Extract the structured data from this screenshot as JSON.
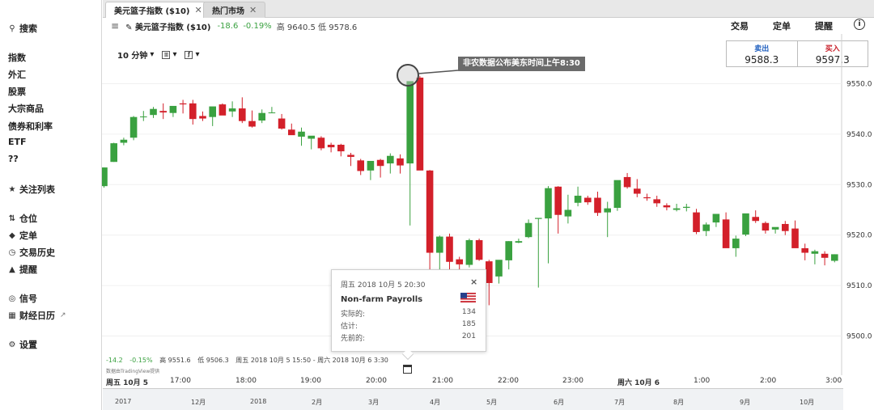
{
  "sidebar": {
    "search": "搜索",
    "categories": [
      "指数",
      "外汇",
      "股票",
      "大宗商品",
      "债券和利率",
      "ETF",
      "??"
    ],
    "watchlist": "关注列表",
    "positions": "仓位",
    "orders": "定单",
    "history": "交易历史",
    "alerts": "提醒",
    "signals": "信号",
    "calendar": "财经日历",
    "settings": "设置"
  },
  "tabs": [
    {
      "label": "美元篮子指数 ($10)",
      "close": "✕"
    },
    {
      "label": "热门市场",
      "close": "✕"
    }
  ],
  "instrument": {
    "name": "美元篮子指数 ($10)",
    "change": "-18.6",
    "change_pct": "-0.19%",
    "high_low": "高 9640.5 低 9578.6"
  },
  "actions": {
    "trade": "交易",
    "order": "定单",
    "alert": "提醒",
    "info": "i"
  },
  "quote": {
    "sell_label": "卖出",
    "sell_value": "9588.3",
    "buy_label": "买入",
    "buy_value": "9597.3"
  },
  "toolbar": {
    "interval": "10 分钟"
  },
  "annotation": "非农数据公布美东时间上午8:30",
  "ohlc_bar": {
    "change": "-14.2",
    "change_pct": "-0.15%",
    "high": "高 9551.6",
    "low": "低 9506.3",
    "range": "周五 2018 10月 5 15:50 - 周六 2018 10月 6 3:30"
  },
  "provider": "数据由TradingView提供",
  "time_axis": {
    "labels": [
      {
        "text": "周五 10月 5",
        "bold": true
      },
      {
        "text": "17:00"
      },
      {
        "text": "18:00"
      },
      {
        "text": "19:00"
      },
      {
        "text": "20:00"
      },
      {
        "text": "21:00"
      },
      {
        "text": "22:00"
      },
      {
        "text": "23:00"
      },
      {
        "text": "周六 10月 6",
        "bold": true
      },
      {
        "text": "1:00"
      },
      {
        "text": "2:00"
      },
      {
        "text": "3:00"
      }
    ]
  },
  "navigator": [
    "2017",
    "12月",
    "2018",
    "2月",
    "3月",
    "4月",
    "5月",
    "6月",
    "7月",
    "8月",
    "9月",
    "10月"
  ],
  "popup": {
    "date": "周五 2018 10月 5 20:30",
    "close": "×",
    "event": "Non-farm Payrolls",
    "rows": [
      {
        "label": "实际的:",
        "value": "134"
      },
      {
        "label": "估计:",
        "value": "185"
      },
      {
        "label": "先前的:",
        "value": "201"
      }
    ]
  },
  "colors": {
    "up": "#3aa140",
    "down": "#d3202a",
    "sell": "#1f5fbf",
    "buy": "#c8202a"
  },
  "chart_data": {
    "type": "candlestick",
    "x_labels": [
      "周五 10月 5",
      "17:00",
      "18:00",
      "19:00",
      "20:00",
      "21:00",
      "22:00",
      "23:00",
      "周六 10月 6",
      "1:00",
      "2:00",
      "3:00"
    ],
    "y_ticks": [
      9500.0,
      9510.0,
      9520.0,
      9530.0,
      9540.0,
      9550.0
    ],
    "ylim": [
      9495,
      9558
    ],
    "candles": [
      [
        9529.7,
        9533.4,
        9529.4,
        9533.4
      ],
      [
        9534.5,
        9538.3,
        9534.5,
        9538.2
      ],
      [
        9538.3,
        9539.3,
        9537.8,
        9538.9
      ],
      [
        9539.3,
        9543.6,
        9538.8,
        9543.4
      ],
      [
        9543.4,
        9544.6,
        9542.6,
        9543.5
      ],
      [
        9543.8,
        9545.4,
        9543.2,
        9545.0
      ],
      [
        9544.6,
        9546.1,
        9543.0,
        9544.3
      ],
      [
        9544.2,
        9545.3,
        9543.4,
        9545.6
      ],
      [
        9546.1,
        9546.8,
        9544.1,
        9545.9
      ],
      [
        9546.1,
        9546.8,
        9541.9,
        9543.0
      ],
      [
        9543.6,
        9544.5,
        9542.6,
        9543.1
      ],
      [
        9543.4,
        9545.1,
        9541.6,
        9545.5
      ],
      [
        9545.9,
        9546.1,
        9543.9,
        9543.7
      ],
      [
        9544.5,
        9546.5,
        9543.4,
        9545.1
      ],
      [
        9545.1,
        9547.3,
        9542.2,
        9542.6
      ],
      [
        9542.6,
        9544.7,
        9541.3,
        9541.5
      ],
      [
        9542.7,
        9544.9,
        9542.2,
        9544.2
      ],
      [
        9544.3,
        9545.4,
        9544.2,
        9544.3
      ],
      [
        9543.1,
        9544.0,
        9540.9,
        9541.1
      ],
      [
        9540.9,
        9542.1,
        9540.2,
        9539.8
      ],
      [
        9539.5,
        9541.3,
        9537.7,
        9540.5
      ],
      [
        9539.1,
        9539.3,
        9537.0,
        9539.7
      ],
      [
        9539.3,
        9539.6,
        9536.8,
        9537.2
      ],
      [
        9537.9,
        9538.3,
        9536.4,
        9537.4
      ],
      [
        9537.9,
        9538.1,
        9535.6,
        9536.6
      ],
      [
        9535.9,
        9536.3,
        9533.7,
        9535.5
      ],
      [
        9534.8,
        9535.1,
        9531.9,
        9532.7
      ],
      [
        9532.8,
        9534.1,
        9530.9,
        9534.7
      ],
      [
        9534.9,
        9535.1,
        9531.4,
        9533.7
      ],
      [
        9534.2,
        9536.2,
        9532.2,
        9535.7
      ],
      [
        9535.2,
        9536.0,
        9532.2,
        9533.8
      ],
      [
        9534.2,
        9536.6,
        9521.9,
        9550.5
      ],
      [
        9551.2,
        9551.5,
        9534.8,
        9532.8
      ],
      [
        9532.8,
        9532.9,
        9508.6,
        9516.5
      ],
      [
        9516.5,
        9519.9,
        9510.9,
        9519.7
      ],
      [
        9519.7,
        9520.3,
        9512.9,
        9514.7
      ],
      [
        9515.2,
        9515.7,
        9511.4,
        9514.2
      ],
      [
        9514.1,
        9519.3,
        9513.6,
        9519.0
      ],
      [
        9519.0,
        9519.3,
        9514.9,
        9515.1
      ],
      [
        9514.8,
        9515.1,
        9506.1,
        9510.5
      ],
      [
        9511.8,
        9514.6,
        9510.4,
        9515.1
      ],
      [
        9515.0,
        9518.8,
        9513.2,
        9518.8
      ],
      [
        9518.5,
        9519.3,
        9518.4,
        9518.8
      ],
      [
        9519.6,
        9523.1,
        9519.4,
        9522.4
      ],
      [
        9523.2,
        9523.4,
        9509.6,
        9523.4
      ],
      [
        9523.3,
        9529.7,
        9514.4,
        9529.3
      ],
      [
        9529.6,
        9529.7,
        9520.3,
        9524.0
      ],
      [
        9523.7,
        9528.0,
        9522.3,
        9525.0
      ],
      [
        9526.4,
        9529.6,
        9525.7,
        9527.8
      ],
      [
        9527.4,
        9527.8,
        9526.0,
        9526.5
      ],
      [
        9527.4,
        9528.6,
        9523.8,
        9524.4
      ],
      [
        9524.5,
        9526.6,
        9519.6,
        9525.3
      ],
      [
        9525.4,
        9529.5,
        9524.8,
        9530.9
      ],
      [
        9531.5,
        9532.3,
        9529.2,
        9529.5
      ],
      [
        9529.2,
        9531.1,
        9527.5,
        9528.2
      ],
      [
        9527.5,
        9528.2,
        9526.8,
        9527.3
      ],
      [
        9527.1,
        9527.8,
        9525.6,
        9526.3
      ],
      [
        9525.9,
        9526.3,
        9524.9,
        9525.5
      ],
      [
        9525.0,
        9526.2,
        9524.7,
        9525.3
      ],
      [
        9525.4,
        9526.2,
        9524.7,
        9525.6
      ],
      [
        9524.5,
        9525.2,
        9520.2,
        9520.6
      ],
      [
        9520.8,
        9522.5,
        9519.8,
        9522.1
      ],
      [
        9522.5,
        9523.4,
        9521.6,
        9524.2
      ],
      [
        9523.1,
        9524.5,
        9518.2,
        9517.4
      ],
      [
        9517.4,
        9519.9,
        9515.7,
        9519.3
      ],
      [
        9520.1,
        9524.2,
        9519.8,
        9524.3
      ],
      [
        9523.6,
        9524.9,
        9522.4,
        9522.8
      ],
      [
        9522.4,
        9522.7,
        9520.3,
        9520.9
      ],
      [
        9521.1,
        9521.4,
        9520.3,
        9521.6
      ],
      [
        9522.2,
        9522.8,
        9520.0,
        9520.8
      ],
      [
        9521.3,
        9522.9,
        9520.8,
        9517.4
      ],
      [
        9517.4,
        9518.3,
        9515.0,
        9516.5
      ],
      [
        9516.3,
        9517.1,
        9514.2,
        9516.8
      ],
      [
        9516.3,
        9516.8,
        9514.0,
        9515.5
      ],
      [
        9514.9,
        9516.2,
        9514.6,
        9516.2
      ]
    ]
  }
}
